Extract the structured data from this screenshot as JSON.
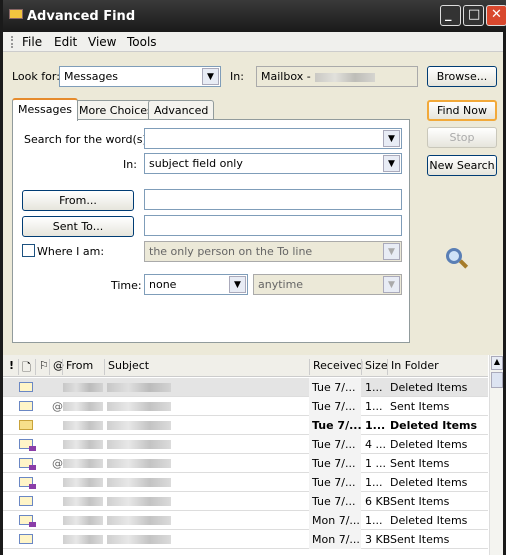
{
  "window": {
    "title": "Advanced Find"
  },
  "menu": [
    "File",
    "Edit",
    "View",
    "Tools"
  ],
  "look_for": {
    "label": "Look for:",
    "value": "Messages"
  },
  "in": {
    "label": "In:",
    "value": "Mailbox - "
  },
  "buttons": {
    "browse": "Browse...",
    "find_now": "Find Now",
    "stop": "Stop",
    "new_search": "New Search",
    "from": "From...",
    "sent_to": "Sent To..."
  },
  "tabs": [
    "Messages",
    "More Choices",
    "Advanced"
  ],
  "form": {
    "search_words_label": "Search for the word(s):",
    "search_words_value": "",
    "in_label": "In:",
    "in_value": "subject field only",
    "from_value": "",
    "sent_to_value": "",
    "where_label": "Where I am:",
    "where_value": "the only person on the To line",
    "time_label": "Time:",
    "time_value": "none",
    "time_range": "anytime"
  },
  "columns": {
    "importance": "!",
    "icon": "",
    "flag": "",
    "attachment": "",
    "from": "From",
    "subject": "Subject",
    "received": "Received",
    "size": "Size",
    "folder": "In Folder"
  },
  "rows": [
    {
      "received": "Tue 7/...",
      "size": "1...",
      "folder": "Deleted Items",
      "attach": false,
      "unread": false,
      "reply": false,
      "selected": true
    },
    {
      "received": "Tue 7/...",
      "size": "1...",
      "folder": "Sent Items",
      "attach": true,
      "unread": false,
      "reply": false
    },
    {
      "received": "Tue 7/...",
      "size": "1...",
      "folder": "Deleted Items",
      "attach": false,
      "unread": true,
      "reply": false
    },
    {
      "received": "Tue 7/...",
      "size": "4 ...",
      "folder": "Deleted Items",
      "attach": false,
      "unread": false,
      "reply": true
    },
    {
      "received": "Tue 7/...",
      "size": "1 ...",
      "folder": "Sent Items",
      "attach": true,
      "unread": false,
      "reply": true
    },
    {
      "received": "Tue 7/...",
      "size": "1...",
      "folder": "Deleted Items",
      "attach": false,
      "unread": false,
      "reply": true
    },
    {
      "received": "Tue 7/...",
      "size": "6 KB",
      "folder": "Sent Items",
      "attach": false,
      "unread": false,
      "reply": false
    },
    {
      "received": "Mon 7/...",
      "size": "1...",
      "folder": "Deleted Items",
      "attach": false,
      "unread": false,
      "reply": true
    },
    {
      "received": "Mon 7/...",
      "size": "3 KB",
      "folder": "Sent Items",
      "attach": false,
      "unread": false,
      "reply": false
    }
  ]
}
